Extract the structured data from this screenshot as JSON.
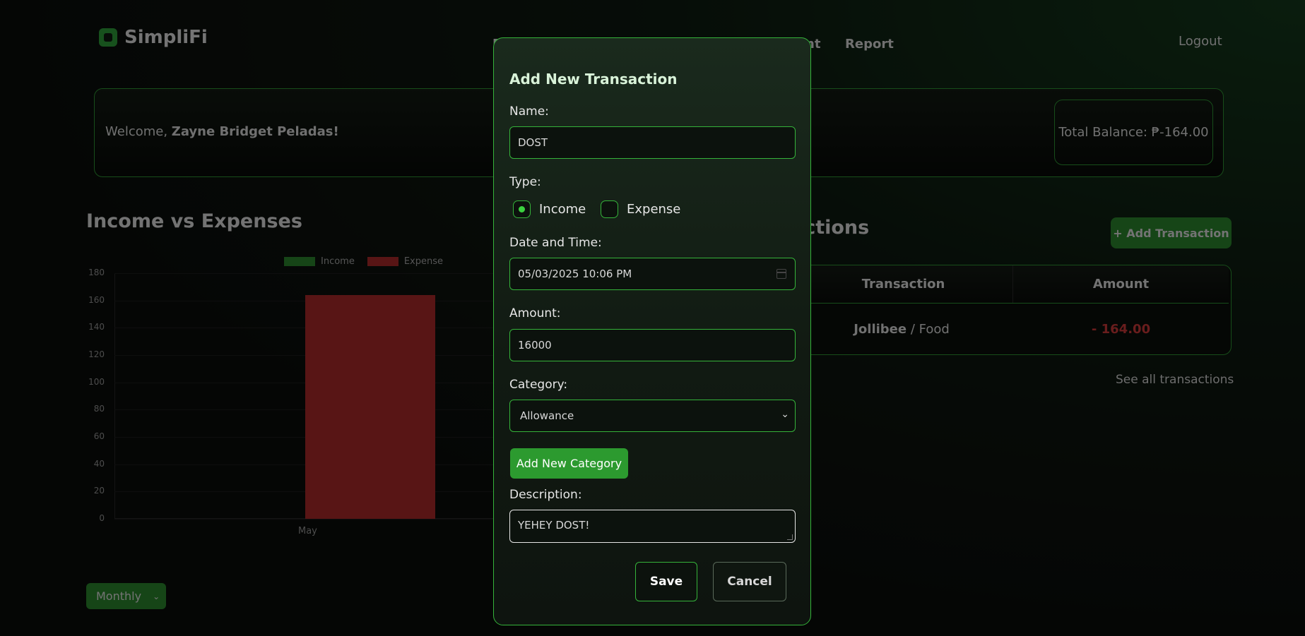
{
  "header": {
    "app_name": "SimpliFi",
    "nav_partial_left": "D",
    "nav_partial_mid": "nt",
    "nav_report": "Report",
    "logout": "Logout"
  },
  "welcome": {
    "prefix": "Welcome, ",
    "user_name": "Zayne Bridget Peladas!",
    "total_balance": "Total Balance: ₱-164.00"
  },
  "chart_section": {
    "title": "Income vs Expenses",
    "period_select": "Monthly"
  },
  "chart_data": {
    "type": "bar",
    "categories": [
      "May"
    ],
    "series": [
      {
        "name": "Income",
        "values": [
          0
        ],
        "color": "#2c8a2f"
      },
      {
        "name": "Expense",
        "values": [
          164
        ],
        "color": "#b02a2a"
      }
    ],
    "yticks": [
      "180",
      "160",
      "140",
      "120",
      "100",
      "80",
      "60",
      "40",
      "20",
      "0"
    ],
    "ylim": [
      0,
      180
    ],
    "legend": "top-center"
  },
  "transactions": {
    "title_partial": "actions",
    "add_button": "+ Add Transaction",
    "columns": [
      "Transaction",
      "Amount"
    ],
    "rows": [
      {
        "name": "Jollibee",
        "category": "/ Food",
        "amount": "- 164.00"
      }
    ],
    "see_all": "See all transactions"
  },
  "modal": {
    "title": "Add New Transaction",
    "name_label": "Name:",
    "name_value": "DOST",
    "type_label": "Type:",
    "type_income": "Income",
    "type_expense": "Expense",
    "type_selected": "Income",
    "datetime_label": "Date and Time:",
    "datetime_value": "05/03/2025 10:06 PM",
    "amount_label": "Amount:",
    "amount_value": "16000",
    "category_label": "Category:",
    "category_value": "Allowance",
    "add_category_button": "Add New Category",
    "description_label": "Description:",
    "description_value": "YEHEY DOST!",
    "save_button": "Save",
    "cancel_button": "Cancel"
  },
  "colors": {
    "accent_green": "#35b33a",
    "expense_red": "#d33a3a"
  }
}
